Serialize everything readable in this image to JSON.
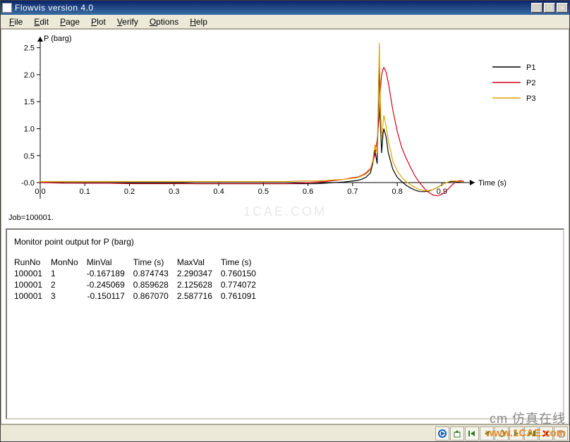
{
  "window": {
    "title": "Flowvis version 4.0",
    "minimize": "_",
    "maximize": "□",
    "close": "×"
  },
  "menu": {
    "file": {
      "label": "File",
      "ul": "F"
    },
    "edit": {
      "label": "Edit",
      "ul": "E"
    },
    "page": {
      "label": "Page",
      "ul": "P"
    },
    "plot": {
      "label": "Plot",
      "ul": "P"
    },
    "verify": {
      "label": "Verify",
      "ul": "V"
    },
    "options": {
      "label": "Options",
      "ul": "O"
    },
    "help": {
      "label": "Help",
      "ul": "H"
    }
  },
  "chart_data": {
    "type": "line",
    "title": "",
    "xlabel": "Time (s)",
    "ylabel": "P (barg)",
    "xlim": [
      0.0,
      0.95
    ],
    "ylim": [
      -0.3,
      2.6
    ],
    "xticks": [
      0.0,
      0.1,
      0.2,
      0.3,
      0.4,
      0.5,
      0.6,
      0.7,
      0.8,
      0.9
    ],
    "yticks": [
      -0.0,
      0.5,
      1.0,
      1.5,
      2.0,
      2.5
    ],
    "job_label": "Job=100001.",
    "legend": {
      "position": "right",
      "entries": [
        "P1",
        "P2",
        "P3"
      ]
    },
    "colors": {
      "P1": "#000000",
      "P2": "#d0021b",
      "P3": "#e2a200"
    },
    "x": [
      0.0,
      0.05,
      0.1,
      0.15,
      0.2,
      0.25,
      0.3,
      0.35,
      0.4,
      0.45,
      0.5,
      0.55,
      0.58,
      0.6,
      0.62,
      0.64,
      0.66,
      0.68,
      0.7,
      0.71,
      0.72,
      0.73,
      0.74,
      0.745,
      0.75,
      0.755,
      0.76,
      0.762,
      0.765,
      0.768,
      0.77,
      0.775,
      0.78,
      0.79,
      0.8,
      0.81,
      0.82,
      0.83,
      0.84,
      0.85,
      0.86,
      0.87,
      0.88,
      0.89,
      0.9,
      0.91,
      0.92,
      0.93,
      0.94,
      0.95
    ],
    "series": [
      {
        "name": "P1",
        "values": [
          0.0,
          0.0,
          -0.01,
          -0.01,
          -0.01,
          -0.01,
          -0.01,
          -0.02,
          -0.02,
          -0.02,
          -0.02,
          -0.02,
          -0.02,
          -0.02,
          -0.02,
          -0.01,
          0.0,
          0.01,
          0.03,
          0.04,
          0.06,
          0.1,
          0.18,
          0.35,
          0.6,
          0.35,
          2.29,
          1.2,
          0.55,
          0.9,
          1.0,
          0.85,
          0.55,
          0.25,
          0.1,
          0.02,
          -0.05,
          -0.1,
          -0.14,
          -0.165,
          -0.167,
          -0.16,
          -0.13,
          -0.09,
          -0.04,
          0.0,
          0.02,
          0.02,
          0.01,
          0.0
        ]
      },
      {
        "name": "P2",
        "values": [
          0.0,
          -0.01,
          -0.01,
          -0.01,
          -0.02,
          -0.02,
          -0.02,
          -0.02,
          -0.02,
          -0.02,
          -0.02,
          -0.02,
          -0.01,
          0.0,
          0.01,
          0.02,
          0.04,
          0.06,
          0.09,
          0.1,
          0.13,
          0.18,
          0.26,
          0.38,
          0.52,
          0.8,
          1.25,
          1.7,
          2.0,
          2.1,
          2.13,
          2.05,
          1.85,
          1.35,
          0.95,
          0.65,
          0.45,
          0.28,
          0.12,
          0.0,
          -0.1,
          -0.18,
          -0.23,
          -0.245,
          -0.22,
          -0.15,
          -0.07,
          0.01,
          0.04,
          0.02
        ]
      },
      {
        "name": "P3",
        "values": [
          0.02,
          0.02,
          0.02,
          0.02,
          0.02,
          0.02,
          0.02,
          0.02,
          0.02,
          0.02,
          0.02,
          0.02,
          0.03,
          0.03,
          0.03,
          0.04,
          0.05,
          0.06,
          0.08,
          0.09,
          0.12,
          0.16,
          0.24,
          0.4,
          0.7,
          0.55,
          2.59,
          1.5,
          0.8,
          1.1,
          1.25,
          1.05,
          0.78,
          0.4,
          0.22,
          0.1,
          0.02,
          -0.04,
          -0.09,
          -0.13,
          -0.15,
          -0.15,
          -0.13,
          -0.09,
          -0.04,
          0.0,
          0.03,
          0.03,
          0.02,
          0.01
        ]
      }
    ]
  },
  "info": {
    "title": "Monitor point output for P (barg)",
    "headers": [
      "RunNo",
      "MonNo",
      "MinVal",
      "Time (s)",
      "MaxVal",
      "Time (s)"
    ],
    "rows": [
      [
        "100001",
        "1",
        "-0.167189",
        "0.874743",
        "2.290347",
        "0.760150"
      ],
      [
        "100001",
        "2",
        "-0.245069",
        "0.859628",
        "2.125628",
        "0.774072"
      ],
      [
        "100001",
        "3",
        "-0.150117",
        "0.867070",
        "2.587716",
        "0.761091"
      ]
    ]
  },
  "toolbar": {
    "play": "►",
    "export": "▣",
    "first": "|◄",
    "prev": "◄",
    "refresh": "⟳",
    "next": "►",
    "last": "►|",
    "delete": "✕",
    "copy": "❐"
  },
  "branding": {
    "line1": "cm 仿真在线",
    "url": "www.1CAE.com"
  },
  "watermark": "1CAE.COM"
}
